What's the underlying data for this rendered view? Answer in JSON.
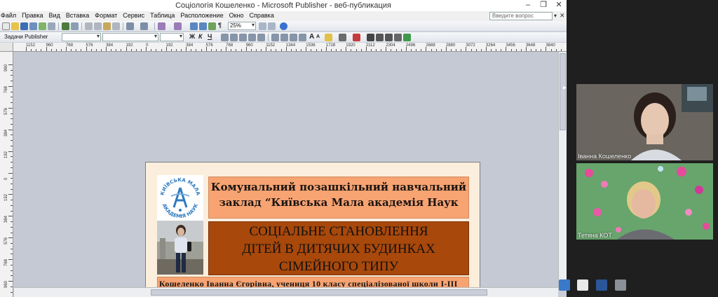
{
  "window": {
    "title": "Соціологія Кошеленко - Microsoft Publisher - веб-публикация",
    "minimize": "–",
    "restore": "❐",
    "close": "✕"
  },
  "menu": {
    "items": [
      "Файл",
      "Правка",
      "Вид",
      "Вставка",
      "Формат",
      "Сервис",
      "Таблица",
      "Расположение",
      "Окно",
      "Справка"
    ],
    "ask_placeholder": "Введите вопрос",
    "ask_dropdown": "▾",
    "close_doc": "✕"
  },
  "toolbar": {
    "zoom": "25%",
    "paragraph_mark": "¶",
    "tasks_label": "Задачи Publisher",
    "bold": "Ж",
    "italic": "К",
    "underline": "Ч",
    "font_grow": "A",
    "font_shrink": "A"
  },
  "ruler": {
    "horizontal": [
      "1152",
      "960",
      "768",
      "576",
      "384",
      "192",
      "0",
      "192",
      "384",
      "576",
      "768",
      "960",
      "1152",
      "1344",
      "1536",
      "1728",
      "1920",
      "2112",
      "2304",
      "2496",
      "2688",
      "2880",
      "3072",
      "3264",
      "3456",
      "3648",
      "3840"
    ],
    "vertical": [
      "960",
      "768",
      "576",
      "384",
      "192",
      "0",
      "192",
      "384",
      "576",
      "768",
      "960"
    ]
  },
  "page": {
    "logo_text_top": "КИЇВСЬКА МАЛА",
    "logo_text_bottom": "АКАДЕМІЯ НАУК",
    "header1": [
      "Комунальний позашкільний навчальний",
      "заклад “Київська Мала академія Наук"
    ],
    "header2": [
      "СОЦІАЛЬНЕ СТАНОВЛЕННЯ",
      "ДІТЕЙ В ДИТЯЧИХ БУДИНКАХ",
      "СІМЕЙНОГО ТИПУ"
    ],
    "author": "Кошеленко Іванна Єгорівна, учениця 10 класу спеціалізованої школи І-ІІІ"
  },
  "participants": [
    {
      "name": "Іванна Кошеленко"
    },
    {
      "name": "Тетяна КОТ"
    }
  ],
  "colors": {
    "header_orange": "#f7a372",
    "title_rust": "#a8480b",
    "page_bg": "#fbeedd",
    "logo_blue": "#2e7bbf"
  }
}
